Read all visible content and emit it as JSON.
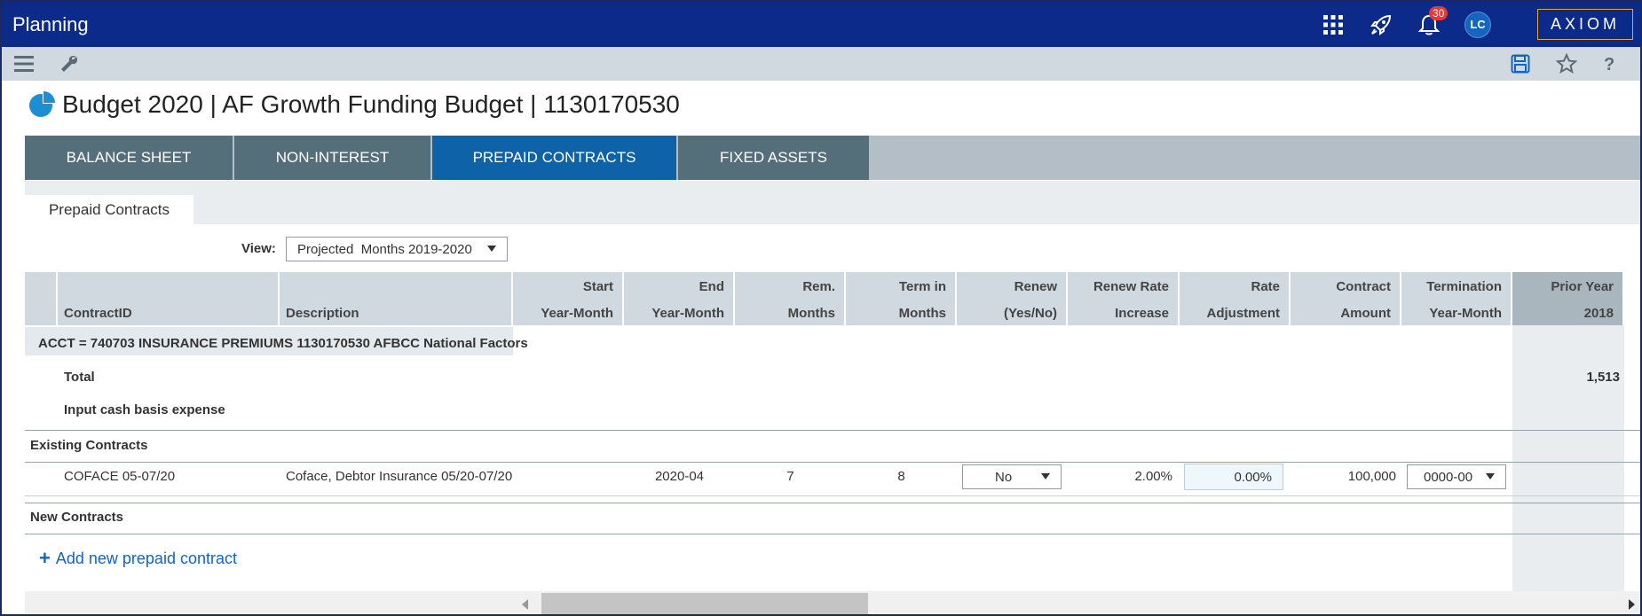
{
  "app": {
    "title": "Planning",
    "notification_count": "30",
    "avatar_initials": "LC",
    "logo_text": "AXIOM"
  },
  "page": {
    "title": "Budget 2020 | AF Growth Funding Budget | 1130170530"
  },
  "tabs": [
    {
      "label": "BALANCE SHEET"
    },
    {
      "label": "NON-INTEREST"
    },
    {
      "label": "PREPAID CONTRACTS"
    },
    {
      "label": "FIXED ASSETS"
    }
  ],
  "subtab": {
    "label": "Prepaid Contracts"
  },
  "view": {
    "label": "View:",
    "selected": "Projected  Months 2019-2020"
  },
  "grid": {
    "headers": {
      "contract_id": "ContractID",
      "description": "Description",
      "start": [
        "Start",
        "Year-Month"
      ],
      "end": [
        "End",
        "Year-Month"
      ],
      "rem": [
        "Rem.",
        "Months"
      ],
      "term": [
        "Term in",
        "Months"
      ],
      "renew": [
        "Renew",
        "(Yes/No)"
      ],
      "renew_rate": [
        "Renew Rate",
        "Increase"
      ],
      "rate_adj": [
        "Rate",
        "Adjustment"
      ],
      "amount": [
        "Contract",
        "Amount"
      ],
      "termination": [
        "Termination",
        "Year-Month"
      ],
      "prior": [
        "Prior Year",
        "2018"
      ]
    },
    "acct_label": "ACCT = 740703 INSURANCE PREMIUMS 1130170530 AFBCC National Factors",
    "total_label": "Total",
    "total_prior": "1,513",
    "input_label": "Input cash basis expense",
    "existing_label": "Existing Contracts",
    "row": {
      "contract_id": "COFACE 05-07/20",
      "description": "Coface, Debtor Insurance 05/20-07/20",
      "end": "2020-04",
      "rem": "7",
      "term": "8",
      "renew": "No",
      "renew_rate": "2.00%",
      "rate_adj": "0.00%",
      "amount": "100,000",
      "termination": "0000-00"
    },
    "new_label": "New Contracts",
    "add_link": "Add new prepaid contract"
  }
}
